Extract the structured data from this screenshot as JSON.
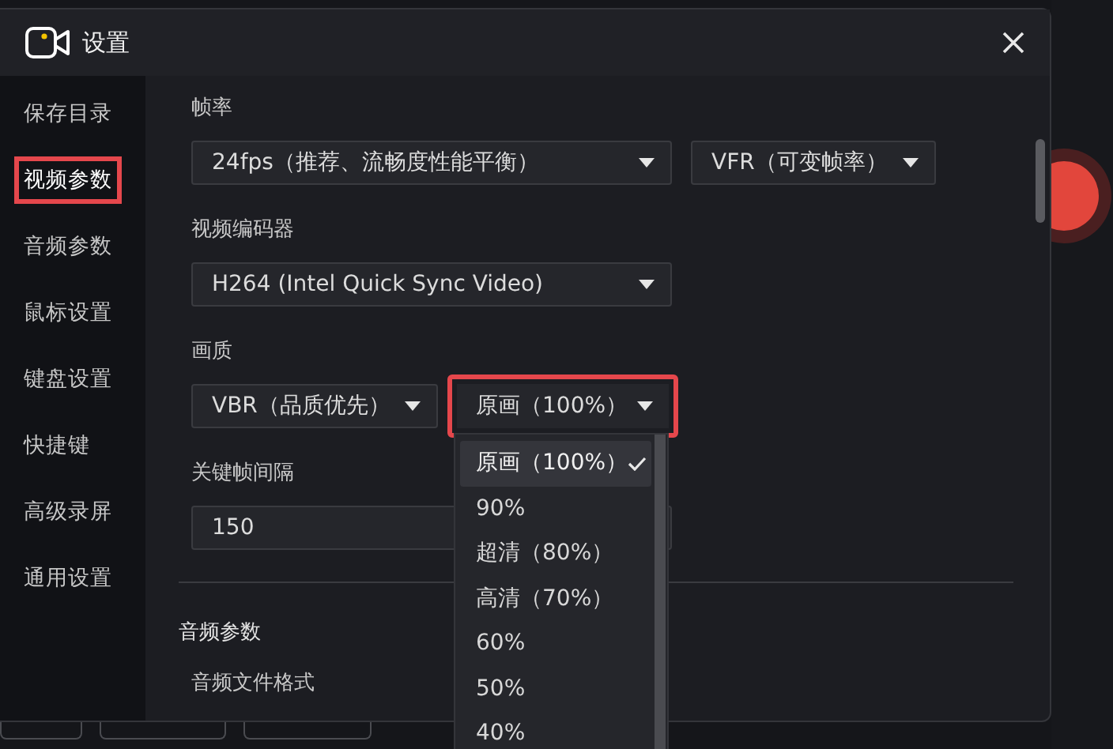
{
  "window": {
    "title": "设置"
  },
  "sidebar": {
    "items": [
      {
        "label": "保存目录",
        "selected": false,
        "highlighted": false
      },
      {
        "label": "视频参数",
        "selected": true,
        "highlighted": true
      },
      {
        "label": "音频参数",
        "selected": false,
        "highlighted": false
      },
      {
        "label": "鼠标设置",
        "selected": false,
        "highlighted": false
      },
      {
        "label": "键盘设置",
        "selected": false,
        "highlighted": false
      },
      {
        "label": "快捷键",
        "selected": false,
        "highlighted": false
      },
      {
        "label": "高级录屏",
        "selected": false,
        "highlighted": false
      },
      {
        "label": "通用设置",
        "selected": false,
        "highlighted": false
      }
    ]
  },
  "video_fields": [
    {
      "label": "帧率",
      "controls": [
        {
          "kind": "select",
          "value": "24fps（推荐、流畅度性能平衡）",
          "highlighted": false
        },
        {
          "kind": "select",
          "value": "VFR（可变帧率）",
          "highlighted": false
        }
      ]
    },
    {
      "label": "视频编码器",
      "controls": [
        {
          "kind": "select",
          "value": "H264 (Intel Quick Sync Video)",
          "highlighted": false
        }
      ]
    },
    {
      "label": "画质",
      "controls": [
        {
          "kind": "select",
          "value": "VBR（品质优先）",
          "highlighted": false
        },
        {
          "kind": "select",
          "value": "原画（100%）",
          "highlighted": true,
          "options": [
            {
              "label": "原画（100%）",
              "selected": true
            },
            {
              "label": "90%",
              "selected": false
            },
            {
              "label": "超清（80%）",
              "selected": false
            },
            {
              "label": "高清（70%）",
              "selected": false
            },
            {
              "label": "60%",
              "selected": false
            },
            {
              "label": "50%",
              "selected": false
            },
            {
              "label": "40%",
              "selected": false
            }
          ]
        }
      ]
    },
    {
      "label": "关键帧间隔",
      "controls": [
        {
          "kind": "input",
          "value": "150",
          "highlighted": false
        }
      ]
    }
  ],
  "audio_section": {
    "title": "音频参数",
    "fields": [
      {
        "label": "音频文件格式"
      }
    ]
  }
}
